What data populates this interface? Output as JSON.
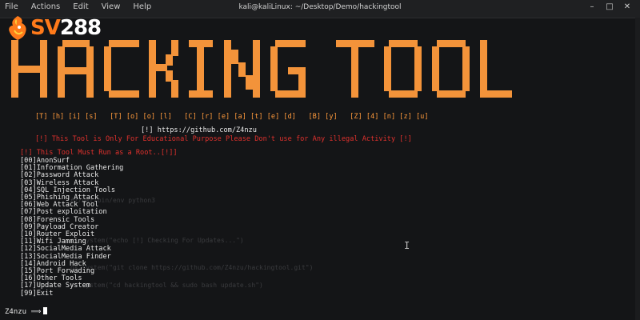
{
  "window": {
    "title": "kali@kaliLinux: ~/Desktop/Demo/hackingtool",
    "menu": [
      "File",
      "Actions",
      "Edit",
      "View",
      "Help"
    ],
    "controls": [
      "–",
      "□",
      "✕"
    ]
  },
  "logo": {
    "brand": "SV",
    "number": "288",
    "icon": "rooster-icon",
    "accent_color": "#ff7a1a"
  },
  "banner": {
    "title": "HACKING TOOL",
    "spaced_name": "[T] [h] [i] [s]   [T] [o] [o] [l]   [C] [r] [e] [a] [t] [e] [d]   [B] [y]   [Z] [4] [n] [z] [u]",
    "github": "[!] https://github.com/Z4nzu",
    "disclaimer": "[!] This Tool is Only For Educational Purpose Please Don't use for Any illegal Activity [!]",
    "root_warning": "[!] This Tool Must Run as a Root..[!]]"
  },
  "menu_items": [
    "[00]AnonSurf",
    "[01]Information Gathering",
    "[02]Password Attack",
    "[03]Wireless Attack",
    "[04]SQL Injection Tools",
    "[05]Phishing Attack",
    "[06]Web Attack Tool",
    "[07]Post exploitation",
    "[08]Forensic Tools",
    "[09]Payload Creator",
    "[10]Router Exploit",
    "[11]Wifi Jamming",
    "[12]SocialMedia Attack",
    "[13]SocialMedia Finder",
    "[14]Android Hack",
    "[15]Port Forwading",
    "[16]Other Tools",
    "[17]Update System",
    "[99]Exit"
  ],
  "prompt": {
    "user": "Z4nzu",
    "arrow": "⟹"
  },
  "colors": {
    "banner": "#ff9a3c",
    "warning": "#e0312d",
    "text": "#e9e9e9",
    "background": "#141517"
  }
}
